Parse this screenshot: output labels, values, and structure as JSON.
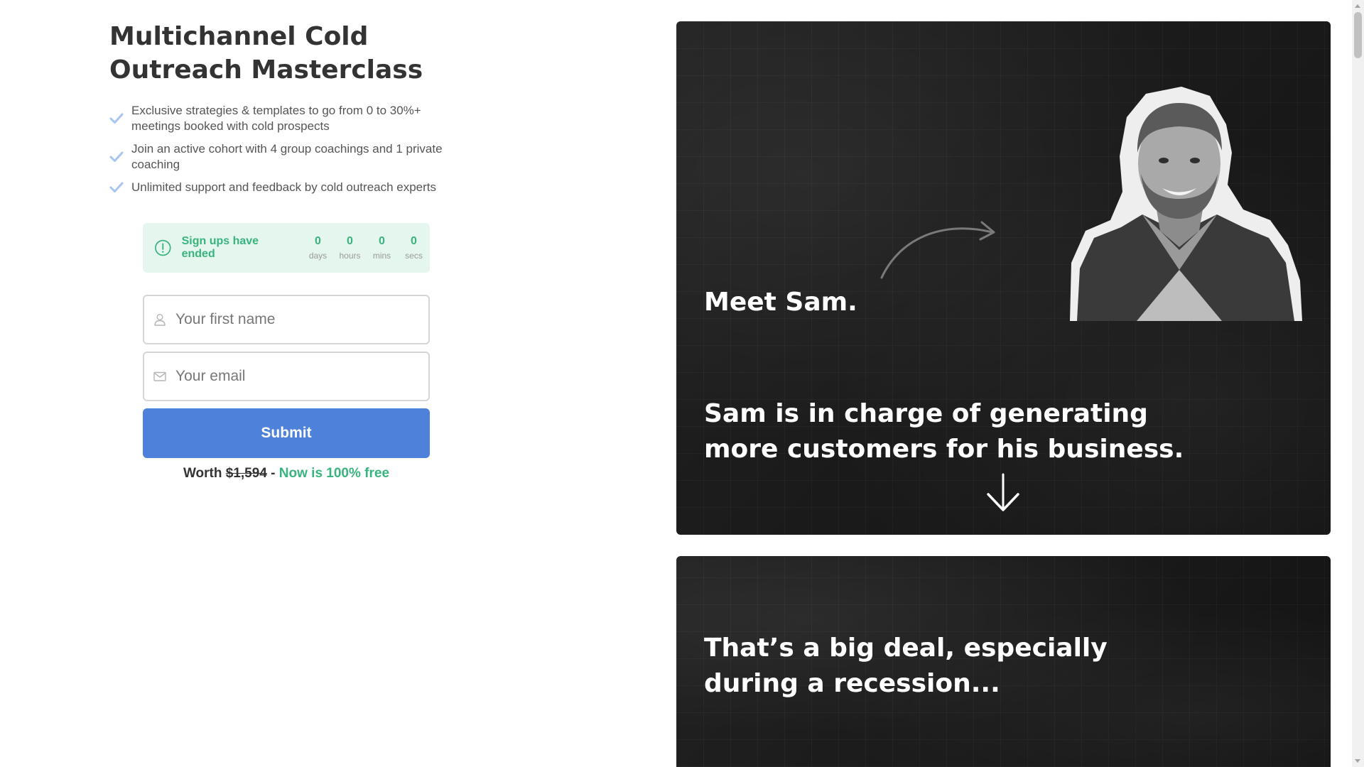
{
  "page": {
    "title": "Multichannel Cold Outreach Masterclass",
    "benefits": [
      "Exclusive strategies & templates to go from 0 to 30%+ meetings booked with cold prospects",
      "Join an active cohort with 4 group coachings and 1 private coaching",
      "Unlimited support and feedback by cold outreach experts"
    ]
  },
  "countdown": {
    "message": "Sign ups have ended",
    "units": [
      {
        "value": "0",
        "label": "days"
      },
      {
        "value": "0",
        "label": "hours"
      },
      {
        "value": "0",
        "label": "mins"
      },
      {
        "value": "0",
        "label": "secs"
      }
    ]
  },
  "form": {
    "first_name_placeholder": "Your first name",
    "email_placeholder": "Your email",
    "submit_label": "Submit",
    "worth_prefix": "Worth",
    "worth_old_price": "$1,594",
    "worth_separator": "-",
    "worth_free": "Now is 100% free"
  },
  "story": {
    "card1_heading": "Meet Sam.",
    "card1_text": "Sam is in charge of generating more customers for his business.",
    "card2_text": "That’s a big deal, especially during a recession..."
  },
  "colors": {
    "accent_green": "#38b47d",
    "countdown_bg": "#e5f6ef",
    "submit_blue": "#4e81d9",
    "check_blue": "#a8c4f0",
    "card_dark": "#191919"
  },
  "icons": {
    "benefit": "check-icon",
    "countdown": "exclamation-circle-icon",
    "first_name": "user-icon",
    "email": "envelope-icon",
    "card_arrow": "curved-arrow-icon",
    "scroll_hint": "chevron-down-icon"
  }
}
